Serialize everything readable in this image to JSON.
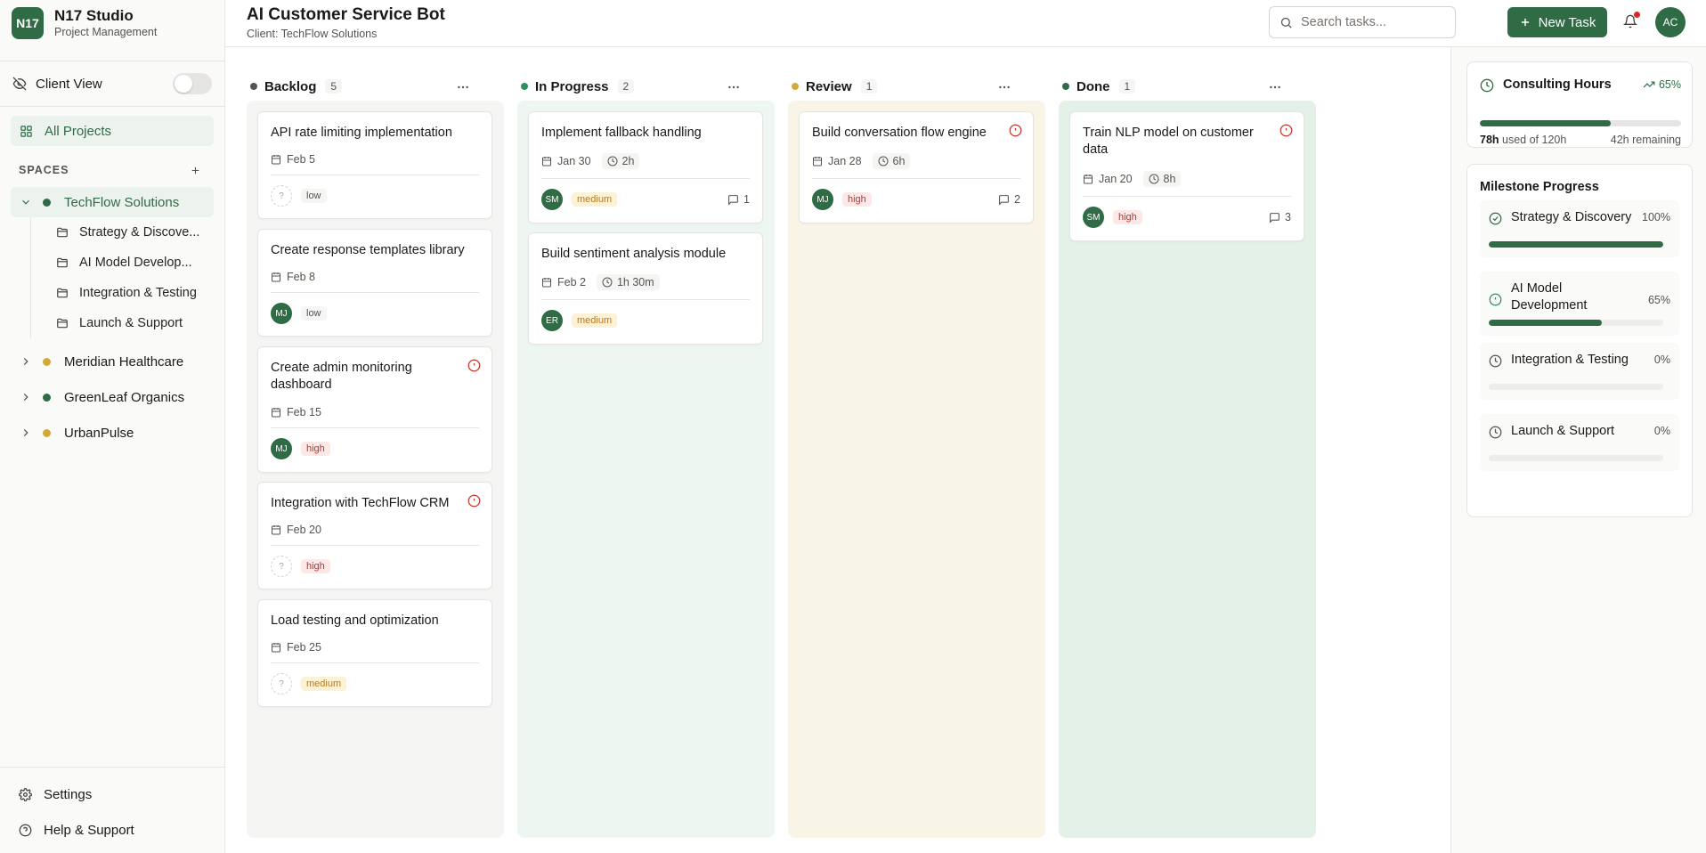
{
  "brand": {
    "logo": "N17",
    "name": "N17 Studio",
    "subtitle": "Project Management"
  },
  "sidebar": {
    "client_view_label": "Client View",
    "client_view_on": false,
    "all_projects": "All Projects",
    "spaces_heading": "SPACES",
    "spaces": [
      {
        "name": "TechFlow Solutions",
        "color": "#2f6b45",
        "expanded": true
      },
      {
        "name": "Meridian Healthcare",
        "color": "#d4a93a",
        "expanded": false
      },
      {
        "name": "GreenLeaf Organics",
        "color": "#2f6b45",
        "expanded": false
      },
      {
        "name": "UrbanPulse",
        "color": "#d4a93a",
        "expanded": false
      }
    ],
    "projects": [
      "Strategy & Discove...",
      "AI Model Develop...",
      "Integration & Testing",
      "Launch & Support"
    ],
    "settings": "Settings",
    "help": "Help & Support"
  },
  "header": {
    "title": "AI Customer Service Bot",
    "subtitle": "Client: TechFlow Solutions",
    "search_placeholder": "Search tasks...",
    "new_task": "New Task",
    "avatar": "AC"
  },
  "board": {
    "columns": [
      {
        "name": "Backlog",
        "count": "5",
        "dot": "#57534e",
        "bg": "#f5f5f4",
        "cards": [
          {
            "title": "API rate limiting implementation",
            "date": "Feb 5",
            "hours": "",
            "assignee": "?",
            "priority": "low",
            "comments": "",
            "alert": false
          },
          {
            "title": "Create response templates library",
            "date": "Feb 8",
            "hours": "",
            "assignee": "MJ",
            "priority": "low",
            "comments": "",
            "alert": false
          },
          {
            "title": "Create admin monitoring dashboard",
            "date": "Feb 15",
            "hours": "",
            "assignee": "MJ",
            "priority": "high",
            "comments": "",
            "alert": true
          },
          {
            "title": "Integration with TechFlow CRM",
            "date": "Feb 20",
            "hours": "",
            "assignee": "?",
            "priority": "high",
            "comments": "",
            "alert": true
          },
          {
            "title": "Load testing and optimization",
            "date": "Feb 25",
            "hours": "",
            "assignee": "?",
            "priority": "medium",
            "comments": "",
            "alert": false
          }
        ]
      },
      {
        "name": "In Progress",
        "count": "2",
        "dot": "#2f8f5b",
        "bg": "#eef6f1",
        "cards": [
          {
            "title": "Implement fallback handling",
            "date": "Jan 30",
            "hours": "2h",
            "assignee": "SM",
            "priority": "medium",
            "comments": "1",
            "alert": false
          },
          {
            "title": "Build sentiment analysis module",
            "date": "Feb 2",
            "hours": "1h 30m",
            "assignee": "ER",
            "priority": "medium",
            "comments": "",
            "alert": false
          }
        ]
      },
      {
        "name": "Review",
        "count": "1",
        "dot": "#d4a93a",
        "bg": "#f8f5e7",
        "cards": [
          {
            "title": "Build conversation flow engine",
            "date": "Jan 28",
            "hours": "6h",
            "assignee": "MJ",
            "priority": "high",
            "comments": "2",
            "alert": true
          }
        ]
      },
      {
        "name": "Done",
        "count": "1",
        "dot": "#2f6b45",
        "bg": "#e3f1e8",
        "cards": [
          {
            "title": "Train NLP model on customer data",
            "date": "Jan 20",
            "hours": "8h",
            "assignee": "SM",
            "priority": "high",
            "comments": "3",
            "alert": true
          }
        ]
      }
    ]
  },
  "hours": {
    "title": "Consulting Hours",
    "trend": "65%",
    "progress": 0.65,
    "used": "78h",
    "used_suffix": " used of 120h",
    "remaining": "42h remaining"
  },
  "milestones": {
    "title": "Milestone Progress",
    "items": [
      {
        "name": "Strategy & Discovery",
        "pct": "100%",
        "progress": 1.0,
        "status": "complete"
      },
      {
        "name": "AI Model Development",
        "pct": "65%",
        "progress": 0.65,
        "status": "in-progress"
      },
      {
        "name": "Integration & Testing",
        "pct": "0%",
        "progress": 0,
        "status": "pending"
      },
      {
        "name": "Launch & Support",
        "pct": "0%",
        "progress": 0,
        "status": "pending"
      }
    ]
  }
}
